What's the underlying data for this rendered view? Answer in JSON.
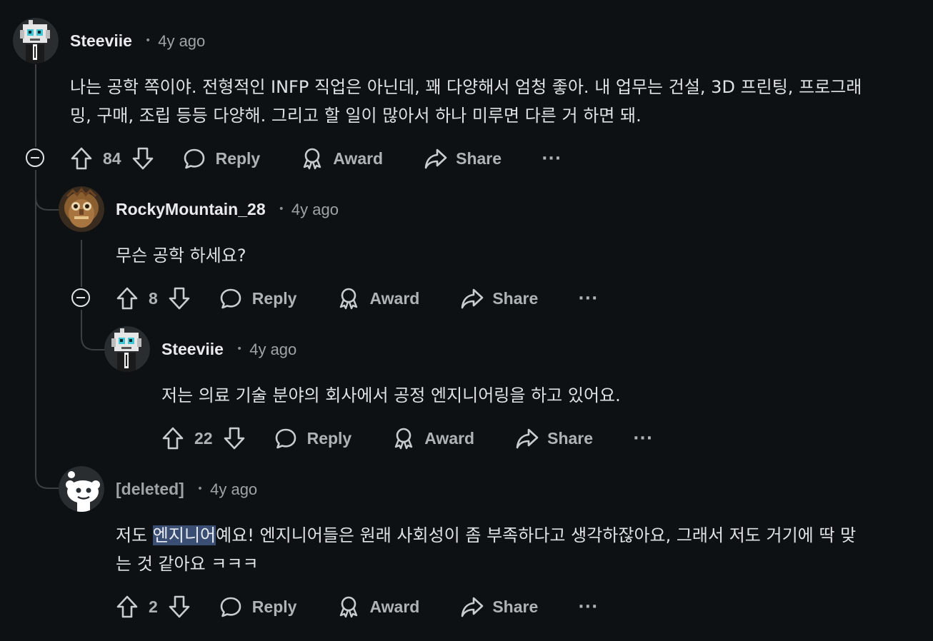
{
  "actions": {
    "reply": "Reply",
    "award": "Award",
    "share": "Share",
    "more": "···"
  },
  "comments": [
    {
      "author": "Steeviie",
      "time": "4y ago",
      "lines": [
        "나는 공학 쪽이야. 전형적인 INFP 직업은 아닌데, 꽤 다양해서 엄청 좋아. 내 업무는 건설, 3D 프린팅, 프로그래",
        "밍, 구매, 조립 등등 다양해. 그리고 할 일이 많아서 하나 미루면 다른 거 하면 돼."
      ],
      "votes": "84"
    },
    {
      "author": "RockyMountain_28",
      "time": "4y ago",
      "lines": [
        "무슨 공학 하세요?"
      ],
      "votes": "8"
    },
    {
      "author": "Steeviie",
      "time": "4y ago",
      "lines": [
        "저는 의료 기술 분야의 회사에서 공정 엔지니어링을 하고 있어요."
      ],
      "votes": "22"
    },
    {
      "author": "[deleted]",
      "time": "4y ago",
      "line1_before": "저도 ",
      "line1_highlight": "엔지니어",
      "line1_after": "예요! 엔지니어들은 원래 사회성이 좀 부족하다고 생각하잖아요, 그래서 저도 거기에 딱 맞",
      "line2": "는 것 같아요 ㅋㅋㅋ",
      "votes": "2"
    }
  ],
  "colors": {
    "background": "#0e1113",
    "text": "#dfe2e4",
    "muted": "#aeb3b7",
    "highlight": "#3a4e74"
  }
}
